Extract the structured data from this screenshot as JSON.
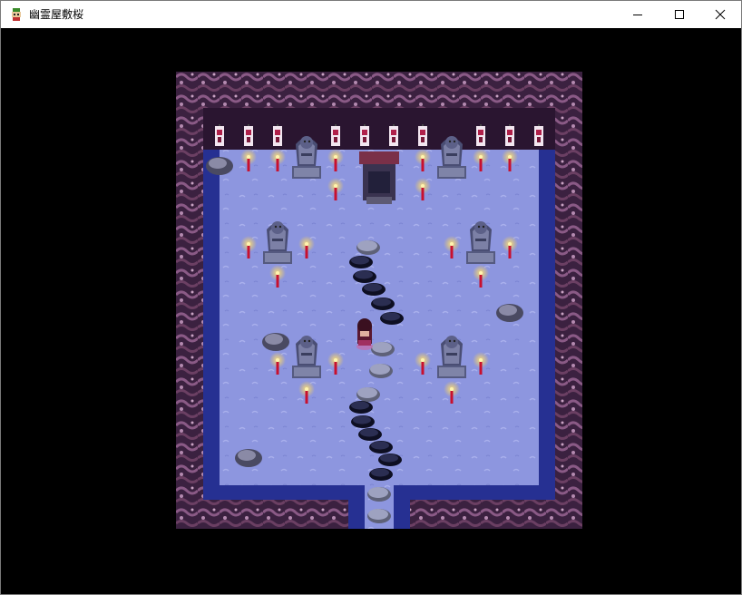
{
  "window": {
    "title": "幽霊屋敷桜",
    "app_icon": "game-app-icon",
    "controls": {
      "minimize": "minimize-icon",
      "maximize": "maximize-icon",
      "close": "close-icon"
    }
  },
  "scene": {
    "name": "shrine-room",
    "palette": {
      "floor": "#8d96df",
      "floor_edge": "#263092",
      "wall_rock": "#6b3f63",
      "background": "#000000",
      "candle": "#c8102e",
      "flame_glow": "#ffd34a"
    }
  }
}
